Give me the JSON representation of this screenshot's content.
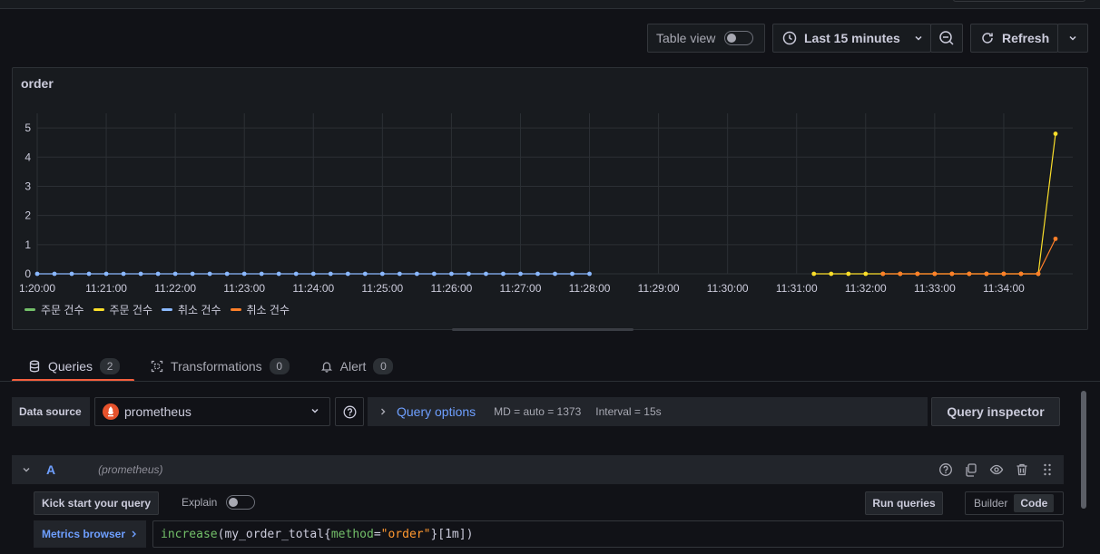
{
  "toolbar": {
    "table_view_label": "Table view",
    "time_range": "Last 15 minutes",
    "refresh_label": "Refresh"
  },
  "panel": {
    "title": "order"
  },
  "chart_data": {
    "type": "line",
    "title": "order",
    "ylim": [
      0,
      5.5
    ],
    "yticks": [
      "0",
      "1",
      "2",
      "3",
      "4",
      "5"
    ],
    "xticks": [
      "1:20:00",
      "11:21:00",
      "11:22:00",
      "11:23:00",
      "11:24:00",
      "11:25:00",
      "11:26:00",
      "11:27:00",
      "11:28:00",
      "11:29:00",
      "11:30:00",
      "11:31:00",
      "11:32:00",
      "11:33:00",
      "11:34:00"
    ],
    "x_start": "11:20:00",
    "x_end": "11:35:00",
    "series": [
      {
        "name": "주문 건수",
        "color": "#73bf69",
        "points": []
      },
      {
        "name": "주문 건수",
        "color": "#fade2a",
        "points": [
          [
            "11:31:15",
            0
          ],
          [
            "11:31:30",
            0
          ],
          [
            "11:31:45",
            0
          ],
          [
            "11:32:00",
            0
          ],
          [
            "11:32:15",
            0
          ],
          [
            "11:32:30",
            0
          ],
          [
            "11:32:45",
            0
          ],
          [
            "11:33:00",
            0
          ],
          [
            "11:33:15",
            0
          ],
          [
            "11:33:30",
            0
          ],
          [
            "11:33:45",
            0
          ],
          [
            "11:34:00",
            0
          ],
          [
            "11:34:15",
            0
          ],
          [
            "11:34:30",
            0
          ],
          [
            "11:34:45",
            4.8
          ]
        ]
      },
      {
        "name": "취소 건수",
        "color": "#8ab8ff",
        "points": [
          [
            "11:20:00",
            0
          ],
          [
            "11:20:15",
            0
          ],
          [
            "11:20:30",
            0
          ],
          [
            "11:20:45",
            0
          ],
          [
            "11:21:00",
            0
          ],
          [
            "11:21:15",
            0
          ],
          [
            "11:21:30",
            0
          ],
          [
            "11:21:45",
            0
          ],
          [
            "11:22:00",
            0
          ],
          [
            "11:22:15",
            0
          ],
          [
            "11:22:30",
            0
          ],
          [
            "11:22:45",
            0
          ],
          [
            "11:23:00",
            0
          ],
          [
            "11:23:15",
            0
          ],
          [
            "11:23:30",
            0
          ],
          [
            "11:23:45",
            0
          ],
          [
            "11:24:00",
            0
          ],
          [
            "11:24:15",
            0
          ],
          [
            "11:24:30",
            0
          ],
          [
            "11:24:45",
            0
          ],
          [
            "11:25:00",
            0
          ],
          [
            "11:25:15",
            0
          ],
          [
            "11:25:30",
            0
          ],
          [
            "11:25:45",
            0
          ],
          [
            "11:26:00",
            0
          ],
          [
            "11:26:15",
            0
          ],
          [
            "11:26:30",
            0
          ],
          [
            "11:26:45",
            0
          ],
          [
            "11:27:00",
            0
          ],
          [
            "11:27:15",
            0
          ],
          [
            "11:27:30",
            0
          ],
          [
            "11:27:45",
            0
          ],
          [
            "11:28:00",
            0
          ]
        ]
      },
      {
        "name": "취소 건수",
        "color": "#ff7f29",
        "points": [
          [
            "11:32:15",
            0
          ],
          [
            "11:32:30",
            0
          ],
          [
            "11:32:45",
            0
          ],
          [
            "11:33:00",
            0
          ],
          [
            "11:33:15",
            0
          ],
          [
            "11:33:30",
            0
          ],
          [
            "11:33:45",
            0
          ],
          [
            "11:34:00",
            0
          ],
          [
            "11:34:15",
            0
          ],
          [
            "11:34:30",
            0
          ],
          [
            "11:34:45",
            1.2
          ]
        ]
      }
    ],
    "grid": true,
    "legend_position": "bottom-left"
  },
  "tabs": [
    {
      "label": "Queries",
      "count": "2"
    },
    {
      "label": "Transformations",
      "count": "0"
    },
    {
      "label": "Alert",
      "count": "0"
    }
  ],
  "datasource": {
    "label": "Data source",
    "name": "prometheus",
    "query_options_label": "Query options",
    "md": "MD = auto = 1373",
    "interval": "Interval = 15s",
    "query_inspector": "Query inspector"
  },
  "query": {
    "ref_id": "A",
    "ds_name": "(prometheus)",
    "kick_start": "Kick start your query",
    "explain_label": "Explain",
    "run_queries": "Run queries",
    "mode_builder": "Builder",
    "mode_code": "Code",
    "metrics_browser": "Metrics browser",
    "expr_fn": "increase",
    "expr_metric": "my_order_total",
    "expr_label": "method",
    "expr_value": "\"order\"",
    "expr_range": "[1m]"
  }
}
